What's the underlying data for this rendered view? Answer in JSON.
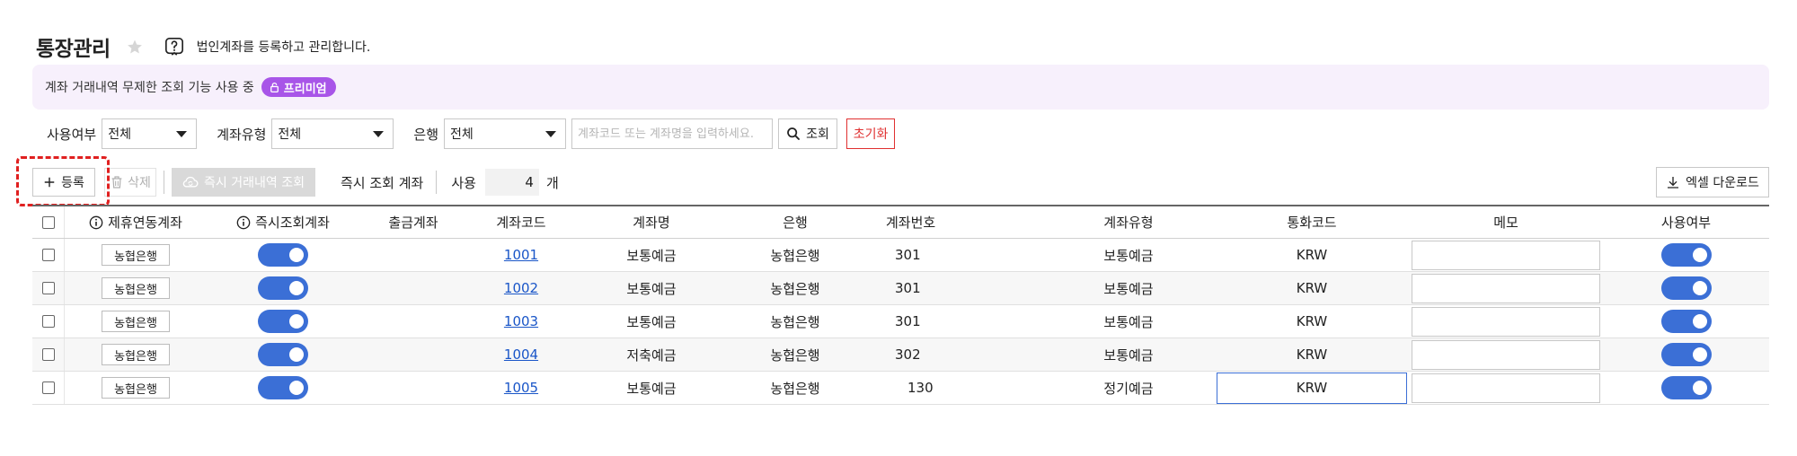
{
  "page": {
    "title": "통장관리",
    "description": "법인계좌를 등록하고 관리합니다."
  },
  "banner": {
    "text": "계좌 거래내역 무제한 조회 기능 사용 중",
    "badge": "프리미엄",
    "badge_color": "#a855e8",
    "background": "#f7f0fc"
  },
  "filters": {
    "usage_label": "사용여부",
    "usage_value": "전체",
    "type_label": "계좌유형",
    "type_value": "전체",
    "bank_label": "은행",
    "bank_value": "전체",
    "search_placeholder": "계좌코드 또는 계좌명을 입력하세요.",
    "search_button": "조회",
    "reset_button": "초기화"
  },
  "toolbar": {
    "register_button": "등록",
    "delete_button": "삭제",
    "instant_button": "즉시 거래내역 조회",
    "instant_label": "즉시 조회 계좌",
    "use_label": "사용",
    "use_count": "4",
    "use_unit": "개",
    "excel_button": "엑셀 다운로드"
  },
  "table": {
    "headers": [
      "제휴연동계좌",
      "즉시조회계좌",
      "출금계좌",
      "계좌코드",
      "계좌명",
      "은행",
      "계좌번호",
      "계좌유형",
      "통화코드",
      "메모",
      "사용여부"
    ],
    "rows": [
      {
        "partner_bank": "농협은행",
        "instant": true,
        "withdraw": "",
        "code": "1001",
        "name": "보통예금",
        "bank": "농협은행",
        "number": "301",
        "type": "보통예금",
        "currency": "KRW",
        "memo": "",
        "active": true
      },
      {
        "partner_bank": "농협은행",
        "instant": true,
        "withdraw": "",
        "code": "1002",
        "name": "보통예금",
        "bank": "농협은행",
        "number": "301",
        "type": "보통예금",
        "currency": "KRW",
        "memo": "",
        "active": true
      },
      {
        "partner_bank": "농협은행",
        "instant": true,
        "withdraw": "",
        "code": "1003",
        "name": "보통예금",
        "bank": "농협은행",
        "number": "301",
        "type": "보통예금",
        "currency": "KRW",
        "memo": "",
        "active": true
      },
      {
        "partner_bank": "농협은행",
        "instant": true,
        "withdraw": "",
        "code": "1004",
        "name": "저축예금",
        "bank": "농협은행",
        "number": "302",
        "type": "보통예금",
        "currency": "KRW",
        "memo": "",
        "active": true
      },
      {
        "partner_bank": "농협은행",
        "instant": true,
        "withdraw": "",
        "code": "1005",
        "name": "보통예금",
        "bank": "농협은행",
        "number": "130",
        "type": "정기예금",
        "currency": "KRW",
        "memo": "",
        "active": true
      }
    ]
  },
  "colors": {
    "accent": "#3b6fd6",
    "link": "#1a56c8",
    "danger": "#e03030"
  }
}
